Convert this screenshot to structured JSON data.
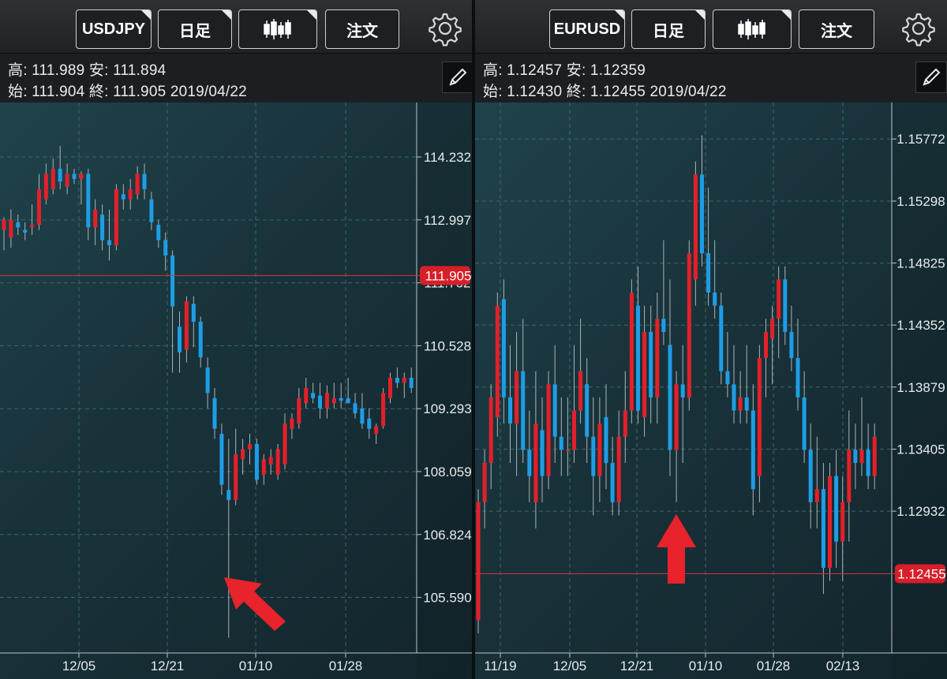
{
  "panels": [
    {
      "toolbar": {
        "symbol": "USDJPY",
        "timeframe": "日足",
        "chart_type_icon": "candlestick-icon",
        "order_label": "注文",
        "settings_icon": "gear-icon"
      },
      "info": {
        "high_label": "高",
        "high": "111.989",
        "low_label": "安",
        "low": "111.894",
        "open_label": "始",
        "open": "111.904",
        "close_label": "終",
        "close": "111.905",
        "date": "2019/04/22"
      },
      "edit_icon": "pencil-icon",
      "annotation": {
        "icon": "arrow-up-left-icon",
        "color": "#e8232b"
      }
    },
    {
      "toolbar": {
        "symbol": "EURUSD",
        "timeframe": "日足",
        "chart_type_icon": "candlestick-icon",
        "order_label": "注文",
        "settings_icon": "gear-icon"
      },
      "info": {
        "high_label": "高",
        "high": "1.12457",
        "low_label": "安",
        "low": "1.12359",
        "open_label": "始",
        "open": "1.12430",
        "close_label": "終",
        "close": "1.12455",
        "date": "2019/04/22"
      },
      "edit_icon": "pencil-icon",
      "annotation": {
        "icon": "arrow-up-icon",
        "color": "#e8232b"
      }
    }
  ],
  "chart_data": [
    {
      "type": "candlestick",
      "symbol": "USDJPY",
      "timeframe": "日足",
      "ylim": [
        104.5,
        115.3
      ],
      "y_ticks": [
        "114.232",
        "112.997",
        "111.762",
        "110.528",
        "109.293",
        "108.059",
        "106.824",
        "105.590"
      ],
      "x_ticks": [
        "12/05",
        "12/21",
        "01/10",
        "01/28"
      ],
      "current_price": "111.905",
      "colors": {
        "up": "#e3202a",
        "down": "#1e9de6",
        "grid": "#3d6670",
        "current_line": "#d8323a"
      },
      "candles": [
        {
          "o": 112.8,
          "h": 113.05,
          "l": 112.4,
          "c": 113.0
        },
        {
          "o": 112.65,
          "h": 113.2,
          "l": 112.45,
          "c": 113.0
        },
        {
          "o": 112.95,
          "h": 113.1,
          "l": 112.7,
          "c": 112.85
        },
        {
          "o": 112.8,
          "h": 112.95,
          "l": 112.6,
          "c": 112.75
        },
        {
          "o": 112.85,
          "h": 113.3,
          "l": 112.7,
          "c": 112.9
        },
        {
          "o": 112.9,
          "h": 113.9,
          "l": 112.8,
          "c": 113.6
        },
        {
          "o": 113.4,
          "h": 114.1,
          "l": 113.3,
          "c": 113.9
        },
        {
          "o": 113.6,
          "h": 114.2,
          "l": 113.5,
          "c": 114.0
        },
        {
          "o": 114.0,
          "h": 114.45,
          "l": 113.6,
          "c": 113.75
        },
        {
          "o": 113.65,
          "h": 114.1,
          "l": 113.5,
          "c": 113.9
        },
        {
          "o": 113.9,
          "h": 114.0,
          "l": 113.7,
          "c": 113.8
        },
        {
          "o": 113.8,
          "h": 113.95,
          "l": 113.3,
          "c": 113.9
        },
        {
          "o": 113.9,
          "h": 114.0,
          "l": 112.6,
          "c": 112.85
        },
        {
          "o": 112.85,
          "h": 113.4,
          "l": 112.5,
          "c": 113.2
        },
        {
          "o": 113.1,
          "h": 113.3,
          "l": 112.4,
          "c": 112.6
        },
        {
          "o": 112.6,
          "h": 113.2,
          "l": 112.2,
          "c": 112.5
        },
        {
          "o": 112.5,
          "h": 113.7,
          "l": 112.4,
          "c": 113.6
        },
        {
          "o": 113.5,
          "h": 113.7,
          "l": 113.2,
          "c": 113.4
        },
        {
          "o": 113.4,
          "h": 113.8,
          "l": 113.2,
          "c": 113.6
        },
        {
          "o": 113.5,
          "h": 114.05,
          "l": 113.4,
          "c": 113.9
        },
        {
          "o": 113.9,
          "h": 114.1,
          "l": 113.4,
          "c": 113.6
        },
        {
          "o": 113.4,
          "h": 113.55,
          "l": 112.8,
          "c": 112.95
        },
        {
          "o": 112.9,
          "h": 113.0,
          "l": 112.45,
          "c": 112.6
        },
        {
          "o": 112.6,
          "h": 112.75,
          "l": 112.0,
          "c": 112.3
        },
        {
          "o": 112.3,
          "h": 112.4,
          "l": 110.0,
          "c": 111.3
        },
        {
          "o": 110.9,
          "h": 111.2,
          "l": 110.0,
          "c": 110.4
        },
        {
          "o": 110.45,
          "h": 111.5,
          "l": 110.2,
          "c": 111.4
        },
        {
          "o": 111.35,
          "h": 111.5,
          "l": 110.5,
          "c": 111.0
        },
        {
          "o": 111.0,
          "h": 111.1,
          "l": 110.1,
          "c": 110.3
        },
        {
          "o": 110.1,
          "h": 110.3,
          "l": 109.3,
          "c": 109.6
        },
        {
          "o": 109.5,
          "h": 109.7,
          "l": 108.7,
          "c": 108.9
        },
        {
          "o": 108.8,
          "h": 109.0,
          "l": 107.6,
          "c": 107.8
        },
        {
          "o": 107.7,
          "h": 108.7,
          "l": 104.8,
          "c": 107.5
        },
        {
          "o": 107.5,
          "h": 108.9,
          "l": 107.4,
          "c": 108.4
        },
        {
          "o": 108.3,
          "h": 108.7,
          "l": 108.0,
          "c": 108.5
        },
        {
          "o": 108.5,
          "h": 108.8,
          "l": 108.2,
          "c": 108.6
        },
        {
          "o": 108.6,
          "h": 108.7,
          "l": 107.8,
          "c": 107.9
        },
        {
          "o": 108.0,
          "h": 108.4,
          "l": 107.8,
          "c": 108.3
        },
        {
          "o": 108.2,
          "h": 108.5,
          "l": 108.0,
          "c": 108.35
        },
        {
          "o": 108.0,
          "h": 108.6,
          "l": 107.9,
          "c": 108.5
        },
        {
          "o": 108.2,
          "h": 109.2,
          "l": 108.1,
          "c": 109.0
        },
        {
          "o": 108.9,
          "h": 109.2,
          "l": 108.7,
          "c": 109.1
        },
        {
          "o": 109.0,
          "h": 109.7,
          "l": 108.9,
          "c": 109.5
        },
        {
          "o": 109.4,
          "h": 109.9,
          "l": 109.3,
          "c": 109.7
        },
        {
          "o": 109.6,
          "h": 109.8,
          "l": 109.4,
          "c": 109.5
        },
        {
          "o": 109.55,
          "h": 109.8,
          "l": 109.1,
          "c": 109.3
        },
        {
          "o": 109.3,
          "h": 109.75,
          "l": 109.1,
          "c": 109.6
        },
        {
          "o": 109.4,
          "h": 109.8,
          "l": 109.3,
          "c": 109.5
        },
        {
          "o": 109.5,
          "h": 109.8,
          "l": 109.3,
          "c": 109.45
        },
        {
          "o": 109.5,
          "h": 109.9,
          "l": 109.4,
          "c": 109.4
        },
        {
          "o": 109.4,
          "h": 109.6,
          "l": 109.1,
          "c": 109.2
        },
        {
          "o": 109.3,
          "h": 109.6,
          "l": 108.9,
          "c": 109.0
        },
        {
          "o": 109.1,
          "h": 109.3,
          "l": 108.7,
          "c": 108.9
        },
        {
          "o": 108.8,
          "h": 109.0,
          "l": 108.6,
          "c": 108.95
        },
        {
          "o": 108.95,
          "h": 109.7,
          "l": 108.9,
          "c": 109.6
        },
        {
          "o": 109.5,
          "h": 110.0,
          "l": 109.4,
          "c": 109.9
        },
        {
          "o": 109.9,
          "h": 110.1,
          "l": 109.7,
          "c": 109.8
        },
        {
          "o": 109.8,
          "h": 110.0,
          "l": 109.5,
          "c": 109.9
        },
        {
          "o": 109.9,
          "h": 110.1,
          "l": 109.6,
          "c": 109.7
        },
        {
          "o": 109.7,
          "h": 109.9,
          "l": 109.5,
          "c": 109.6
        }
      ]
    },
    {
      "type": "candlestick",
      "symbol": "EURUSD",
      "timeframe": "日足",
      "ylim": [
        1.1185,
        1.1605
      ],
      "y_ticks": [
        "1.15772",
        "1.15298",
        "1.14825",
        "1.14352",
        "1.13879",
        "1.13405",
        "1.12932",
        "1.12455"
      ],
      "x_ticks": [
        "11/19",
        "12/05",
        "12/21",
        "01/10",
        "01/28",
        "02/13"
      ],
      "current_price": "1.12455",
      "colors": {
        "up": "#e3202a",
        "down": "#1e9de6",
        "grid": "#3d6670",
        "current_line": "#d8323a"
      },
      "candles": [
        {
          "o": 1.121,
          "h": 1.131,
          "l": 1.12,
          "c": 1.13
        },
        {
          "o": 1.13,
          "h": 1.134,
          "l": 1.128,
          "c": 1.133
        },
        {
          "o": 1.133,
          "h": 1.139,
          "l": 1.131,
          "c": 1.138
        },
        {
          "o": 1.1365,
          "h": 1.146,
          "l": 1.135,
          "c": 1.145
        },
        {
          "o": 1.1455,
          "h": 1.147,
          "l": 1.136,
          "c": 1.138
        },
        {
          "o": 1.138,
          "h": 1.142,
          "l": 1.133,
          "c": 1.136
        },
        {
          "o": 1.136,
          "h": 1.143,
          "l": 1.132,
          "c": 1.14
        },
        {
          "o": 1.14,
          "h": 1.144,
          "l": 1.133,
          "c": 1.134
        },
        {
          "o": 1.134,
          "h": 1.137,
          "l": 1.13,
          "c": 1.132
        },
        {
          "o": 1.13,
          "h": 1.14,
          "l": 1.128,
          "c": 1.136
        },
        {
          "o": 1.1355,
          "h": 1.138,
          "l": 1.13,
          "c": 1.132
        },
        {
          "o": 1.132,
          "h": 1.14,
          "l": 1.131,
          "c": 1.139
        },
        {
          "o": 1.139,
          "h": 1.142,
          "l": 1.133,
          "c": 1.135
        },
        {
          "o": 1.135,
          "h": 1.138,
          "l": 1.132,
          "c": 1.134
        },
        {
          "o": 1.134,
          "h": 1.138,
          "l": 1.132,
          "c": 1.134
        },
        {
          "o": 1.134,
          "h": 1.142,
          "l": 1.133,
          "c": 1.137
        },
        {
          "o": 1.137,
          "h": 1.144,
          "l": 1.136,
          "c": 1.14
        },
        {
          "o": 1.139,
          "h": 1.141,
          "l": 1.133,
          "c": 1.135
        },
        {
          "o": 1.135,
          "h": 1.138,
          "l": 1.129,
          "c": 1.132
        },
        {
          "o": 1.132,
          "h": 1.138,
          "l": 1.13,
          "c": 1.136
        },
        {
          "o": 1.1365,
          "h": 1.139,
          "l": 1.131,
          "c": 1.133
        },
        {
          "o": 1.133,
          "h": 1.135,
          "l": 1.129,
          "c": 1.13
        },
        {
          "o": 1.13,
          "h": 1.137,
          "l": 1.129,
          "c": 1.135
        },
        {
          "o": 1.135,
          "h": 1.14,
          "l": 1.133,
          "c": 1.137
        },
        {
          "o": 1.137,
          "h": 1.147,
          "l": 1.136,
          "c": 1.146
        },
        {
          "o": 1.145,
          "h": 1.148,
          "l": 1.136,
          "c": 1.137
        },
        {
          "o": 1.1365,
          "h": 1.145,
          "l": 1.135,
          "c": 1.143
        },
        {
          "o": 1.143,
          "h": 1.145,
          "l": 1.136,
          "c": 1.138
        },
        {
          "o": 1.138,
          "h": 1.146,
          "l": 1.136,
          "c": 1.144
        },
        {
          "o": 1.144,
          "h": 1.15,
          "l": 1.142,
          "c": 1.143
        },
        {
          "o": 1.142,
          "h": 1.147,
          "l": 1.132,
          "c": 1.134
        },
        {
          "o": 1.134,
          "h": 1.14,
          "l": 1.13,
          "c": 1.139
        },
        {
          "o": 1.139,
          "h": 1.142,
          "l": 1.133,
          "c": 1.138
        },
        {
          "o": 1.138,
          "h": 1.15,
          "l": 1.137,
          "c": 1.149
        },
        {
          "o": 1.147,
          "h": 1.156,
          "l": 1.145,
          "c": 1.155
        },
        {
          "o": 1.155,
          "h": 1.158,
          "l": 1.148,
          "c": 1.149
        },
        {
          "o": 1.149,
          "h": 1.154,
          "l": 1.145,
          "c": 1.146
        },
        {
          "o": 1.146,
          "h": 1.15,
          "l": 1.144,
          "c": 1.145
        },
        {
          "o": 1.145,
          "h": 1.146,
          "l": 1.139,
          "c": 1.14
        },
        {
          "o": 1.14,
          "h": 1.143,
          "l": 1.138,
          "c": 1.139
        },
        {
          "o": 1.139,
          "h": 1.142,
          "l": 1.136,
          "c": 1.137
        },
        {
          "o": 1.137,
          "h": 1.14,
          "l": 1.136,
          "c": 1.138
        },
        {
          "o": 1.138,
          "h": 1.142,
          "l": 1.136,
          "c": 1.137
        },
        {
          "o": 1.137,
          "h": 1.139,
          "l": 1.129,
          "c": 1.131
        },
        {
          "o": 1.132,
          "h": 1.142,
          "l": 1.13,
          "c": 1.141
        },
        {
          "o": 1.141,
          "h": 1.144,
          "l": 1.138,
          "c": 1.143
        },
        {
          "o": 1.1425,
          "h": 1.145,
          "l": 1.139,
          "c": 1.144
        },
        {
          "o": 1.144,
          "h": 1.148,
          "l": 1.141,
          "c": 1.147
        },
        {
          "o": 1.147,
          "h": 1.148,
          "l": 1.142,
          "c": 1.143
        },
        {
          "o": 1.143,
          "h": 1.145,
          "l": 1.14,
          "c": 1.141
        },
        {
          "o": 1.141,
          "h": 1.144,
          "l": 1.137,
          "c": 1.138
        },
        {
          "o": 1.138,
          "h": 1.14,
          "l": 1.133,
          "c": 1.134
        },
        {
          "o": 1.134,
          "h": 1.136,
          "l": 1.128,
          "c": 1.13
        },
        {
          "o": 1.13,
          "h": 1.135,
          "l": 1.128,
          "c": 1.131
        },
        {
          "o": 1.131,
          "h": 1.133,
          "l": 1.123,
          "c": 1.125
        },
        {
          "o": 1.125,
          "h": 1.133,
          "l": 1.124,
          "c": 1.132
        },
        {
          "o": 1.132,
          "h": 1.134,
          "l": 1.125,
          "c": 1.127
        },
        {
          "o": 1.127,
          "h": 1.132,
          "l": 1.124,
          "c": 1.13
        },
        {
          "o": 1.13,
          "h": 1.137,
          "l": 1.127,
          "c": 1.134
        },
        {
          "o": 1.134,
          "h": 1.136,
          "l": 1.131,
          "c": 1.133
        },
        {
          "o": 1.133,
          "h": 1.138,
          "l": 1.132,
          "c": 1.134
        },
        {
          "o": 1.134,
          "h": 1.136,
          "l": 1.131,
          "c": 1.132
        },
        {
          "o": 1.132,
          "h": 1.136,
          "l": 1.131,
          "c": 1.135
        }
      ]
    }
  ]
}
